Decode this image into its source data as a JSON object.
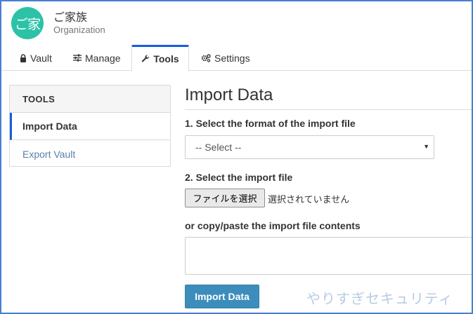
{
  "org": {
    "avatar_text": "ご家",
    "name": "ご家族",
    "type": "Organization",
    "avatar_color": "#2bc2a6"
  },
  "tabs": [
    {
      "label": "Vault",
      "icon": "lock-icon",
      "active": false
    },
    {
      "label": "Manage",
      "icon": "sliders-icon",
      "active": false
    },
    {
      "label": "Tools",
      "icon": "wrench-icon",
      "active": true
    },
    {
      "label": "Settings",
      "icon": "cogs-icon",
      "active": false
    }
  ],
  "side_panel": {
    "header": "TOOLS",
    "items": [
      {
        "label": "Import Data",
        "active": true
      },
      {
        "label": "Export Vault",
        "active": false
      }
    ]
  },
  "main": {
    "title": "Import Data",
    "format_label": "1. Select the format of the import file",
    "format_select_value": "-- Select --",
    "file_label": "2. Select the import file",
    "file_button": "ファイルを選択",
    "file_status": "選択されていません",
    "paste_label": "or copy/paste the import file contents",
    "paste_value": "",
    "submit_label": "Import Data"
  },
  "watermark": "やりすぎセキュリティ",
  "colors": {
    "accent": "#175ddc",
    "button_primary": "#3c8dbc",
    "link": "#5a7fa8",
    "frame_border": "#4a7fd1"
  }
}
